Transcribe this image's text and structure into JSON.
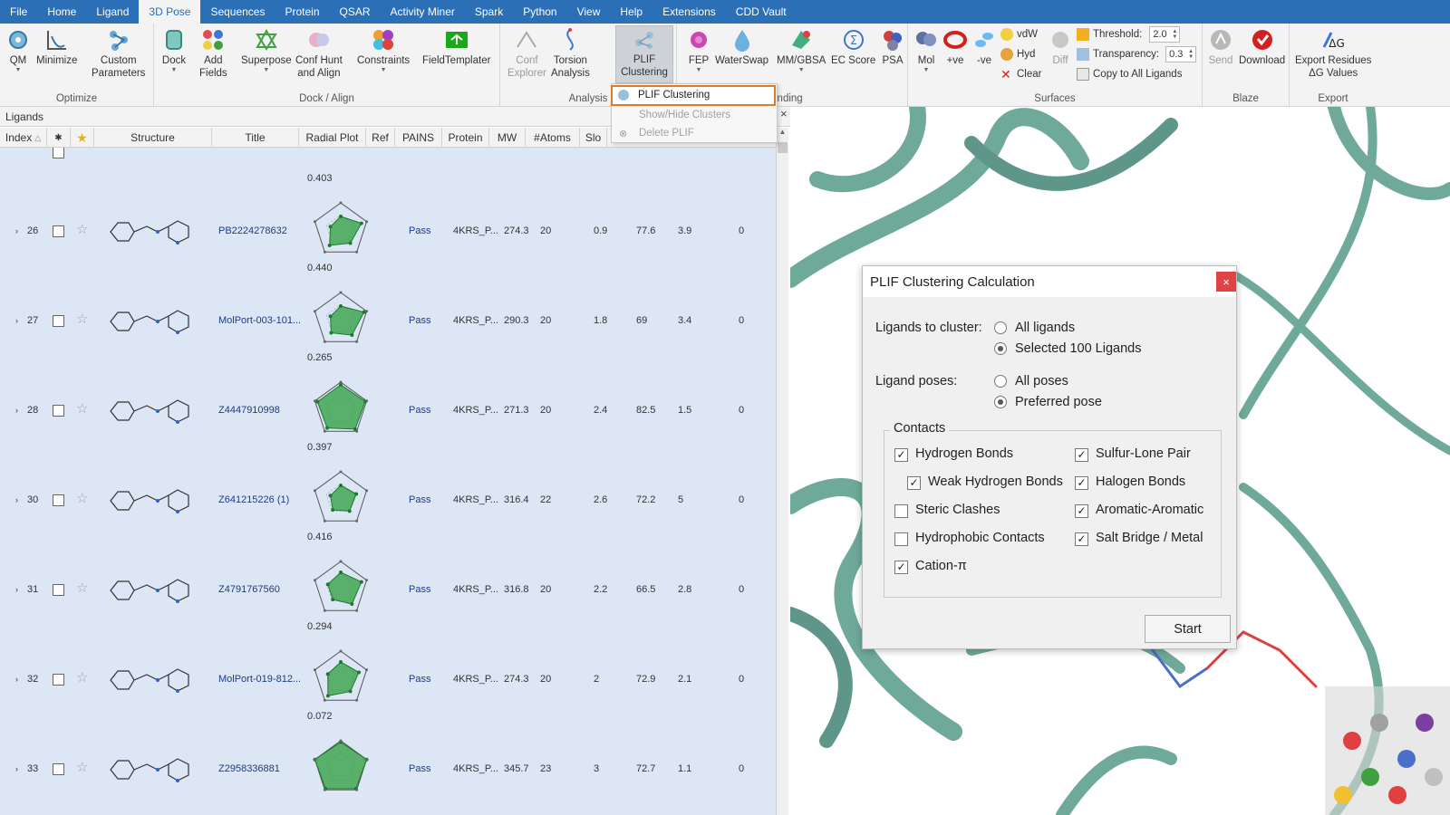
{
  "menu": {
    "items": [
      "File",
      "Home",
      "Ligand",
      "3D Pose",
      "Sequences",
      "Protein",
      "QSAR",
      "Activity Miner",
      "Spark",
      "Python",
      "View",
      "Help",
      "Extensions",
      "CDD Vault"
    ],
    "active": "3D Pose"
  },
  "ribbon": {
    "groups": {
      "optimize": "Optimize",
      "dock_align": "Dock / Align",
      "analysis": "Analysis",
      "binding": "inding",
      "surfaces": "Surfaces",
      "blaze": "Blaze",
      "export": "Export"
    },
    "buttons": {
      "qm": "QM",
      "minimize": "Minimize",
      "custom_params_1": "Custom",
      "custom_params_2": "Parameters",
      "dock": "Dock",
      "add_fields_1": "Add",
      "add_fields_2": "Fields",
      "superpose": "Superpose",
      "conf_hunt_1": "Conf Hunt",
      "conf_hunt_2": "and Align",
      "constraints": "Constraints",
      "field_templater": "FieldTemplater",
      "conf_explorer_1": "Conf",
      "conf_explorer_2": "Explorer",
      "torsion_1": "Torsion",
      "torsion_2": "Analysis",
      "plif_1": "PLIF",
      "plif_2": "Clustering",
      "fep": "FEP",
      "waterswap": "WaterSwap",
      "mmgbsa": "MM/GBSA",
      "ec_score": "EC Score",
      "psa": "PSA",
      "mol": "Mol",
      "pos": "+ve",
      "neg": "-ve",
      "diff": "Diff",
      "vdw": "vdW",
      "hyd": "Hyd",
      "clear": "Clear",
      "threshold": "Threshold:",
      "threshold_value": "2.0",
      "transparency": "Transparency:",
      "transparency_value": "0.3",
      "copy_all": "Copy to All Ligands",
      "send": "Send",
      "download": "Download",
      "export_1": "Export Residues",
      "export_2": "ΔG Values"
    }
  },
  "dropdown": {
    "items": [
      "PLIF Clustering",
      "Show/Hide Clusters",
      "Delete PLIF"
    ]
  },
  "ligands_panel": {
    "title": "Ligands",
    "close": "×",
    "columns": [
      "Index",
      "",
      "",
      "Structure",
      "Title",
      "Radial Plot",
      "Ref",
      "PAINS",
      "Protein",
      "MW",
      "#Atoms",
      "Slo"
    ],
    "index_sort": "△",
    "rows": [
      {
        "index": "26",
        "title": "PB2224278632",
        "score": "0.403",
        "pains": "Pass",
        "protein": "4KRS_P...",
        "mw": "274.3",
        "atoms": "20",
        "c1": "0.9",
        "c2": "77.6",
        "c3": "3.9",
        "c4": "0"
      },
      {
        "index": "27",
        "title": "MolPort-003-101...",
        "score": "0.440",
        "pains": "Pass",
        "protein": "4KRS_P...",
        "mw": "290.3",
        "atoms": "20",
        "c1": "1.8",
        "c2": "69",
        "c3": "3.4",
        "c4": "0"
      },
      {
        "index": "28",
        "title": "Z4447910998",
        "score": "0.265",
        "pains": "Pass",
        "protein": "4KRS_P...",
        "mw": "271.3",
        "atoms": "20",
        "c1": "2.4",
        "c2": "82.5",
        "c3": "1.5",
        "c4": "0"
      },
      {
        "index": "30",
        "title": "Z641215226 (1)",
        "score": "0.397",
        "pains": "Pass",
        "protein": "4KRS_P...",
        "mw": "316.4",
        "atoms": "22",
        "c1": "2.6",
        "c2": "72.2",
        "c3": "5",
        "c4": "0"
      },
      {
        "index": "31",
        "title": "Z4791767560",
        "score": "0.416",
        "pains": "Pass",
        "protein": "4KRS_P...",
        "mw": "316.8",
        "atoms": "20",
        "c1": "2.2",
        "c2": "66.5",
        "c3": "2.8",
        "c4": "0"
      },
      {
        "index": "32",
        "title": "MolPort-019-812...",
        "score": "0.294",
        "pains": "Pass",
        "protein": "4KRS_P...",
        "mw": "274.3",
        "atoms": "20",
        "c1": "2",
        "c2": "72.9",
        "c3": "2.1",
        "c4": "0"
      },
      {
        "index": "33",
        "title": "Z2958336881",
        "score": "0.072",
        "pains": "Pass",
        "protein": "4KRS_P...",
        "mw": "345.7",
        "atoms": "23",
        "c1": "3",
        "c2": "72.7",
        "c3": "1.1",
        "c4": "0"
      }
    ]
  },
  "dialog": {
    "title": "PLIF Clustering Calculation",
    "close": "×",
    "ligands_label": "Ligands to cluster:",
    "ligands_options": [
      "All ligands",
      "Selected 100 Ligands"
    ],
    "poses_label": "Ligand poses:",
    "poses_options": [
      "All poses",
      "Preferred pose"
    ],
    "contacts_label": "Contacts",
    "contacts": {
      "hbond": "Hydrogen Bonds",
      "weak_hbond": "Weak Hydrogen Bonds",
      "steric": "Steric Clashes",
      "hydrophobic": "Hydrophobic Contacts",
      "cation_pi": "Cation-π",
      "sulfur": "Sulfur-Lone Pair",
      "halogen": "Halogen Bonds",
      "aromatic": "Aromatic-Aromatic",
      "salt": "Salt Bridge / Metal"
    },
    "checked": {
      "hbond": true,
      "weak_hbond": true,
      "steric": false,
      "hydrophobic": false,
      "cation_pi": true,
      "sulfur": true,
      "halogen": true,
      "aromatic": true,
      "salt": true
    },
    "start": "Start"
  },
  "colors": {
    "menubar": "#2b6fb6",
    "accent_highlight": "#e07a2a",
    "row_bg": "#dce6f4",
    "radar_fill": "#2e9e3e",
    "protein_ribbon": "#6fa99a",
    "dialog_close": "#e04343"
  }
}
